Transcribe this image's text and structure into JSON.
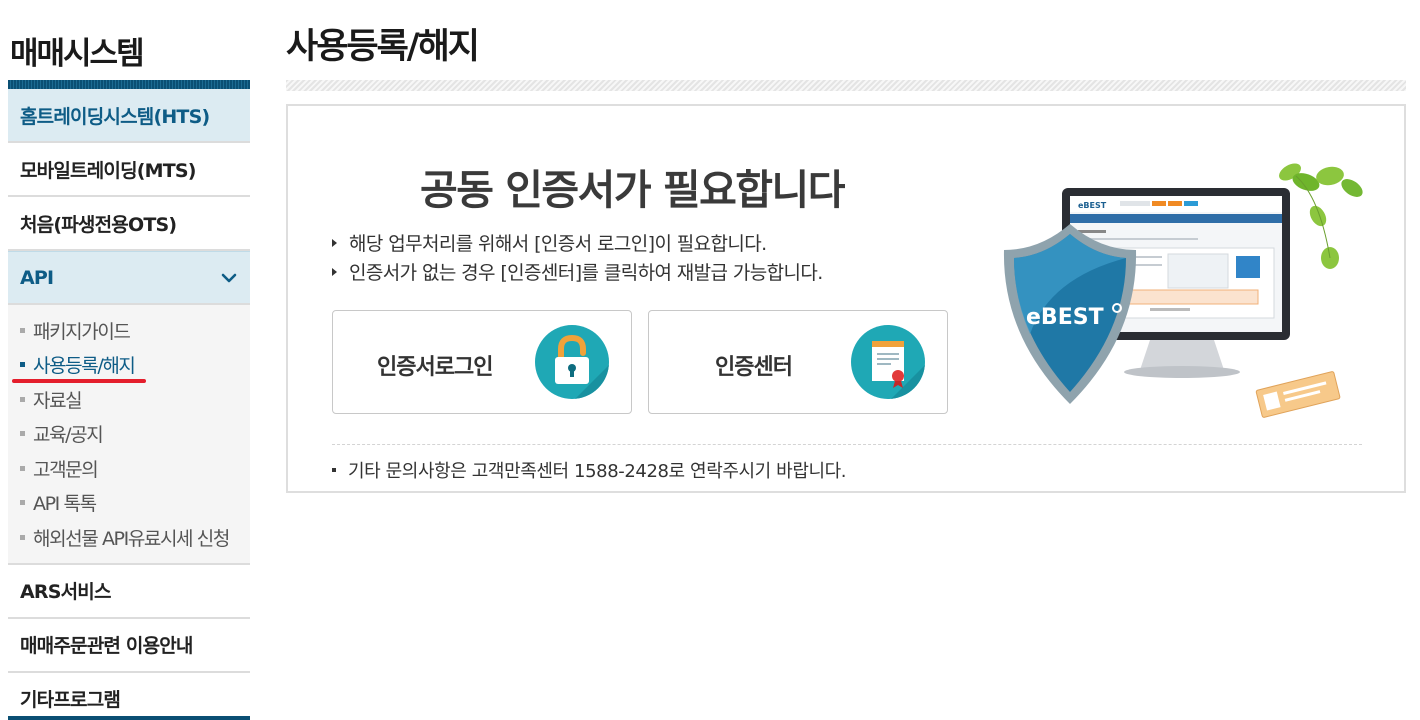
{
  "sidebar": {
    "title": "매매시스템",
    "items": [
      {
        "label": "홈트레이딩시스템(HTS)"
      },
      {
        "label": "모바일트레이딩(MTS)"
      },
      {
        "label": "처음(파생전용OTS)"
      },
      {
        "label": "API"
      },
      {
        "label": "ARS서비스"
      },
      {
        "label": "매매주문관련 이용안내"
      },
      {
        "label": "기타프로그램"
      }
    ],
    "api_submenu": [
      {
        "label": "패키지가이드"
      },
      {
        "label": "사용등록/해지"
      },
      {
        "label": "자료실"
      },
      {
        "label": "교육/공지"
      },
      {
        "label": "고객문의"
      },
      {
        "label": "API 톡톡"
      },
      {
        "label": "해외선물 API유료시세 신청"
      }
    ],
    "expand_icon": "chevron-down-icon"
  },
  "main": {
    "page_title": "사용등록/해지",
    "heading": "공동 인증서가 필요합니다",
    "descriptions": [
      "해당 업무처리를 위해서 [인증서 로그인]이 필요합니다.",
      "인증서가 없는 경우 [인증센터]를 클릭하여 재발급 가능합니다."
    ],
    "buttons": {
      "login_label": "인증서로그인",
      "login_icon": "lock-icon",
      "center_label": "인증센터",
      "center_icon": "certificate-icon"
    },
    "contact": "기타 문의사항은 고객만족센터 1588-2428로 연락주시기 바랍니다.",
    "illustration": {
      "shield_brand": "eBEST",
      "monitor_brand": "eBEST"
    }
  },
  "colors": {
    "accent": "#0e5c86",
    "sidebar_active_bg": "#dcebf2",
    "icon_teal": "#1fa8b5",
    "highlight_underline": "#e41e2c"
  }
}
